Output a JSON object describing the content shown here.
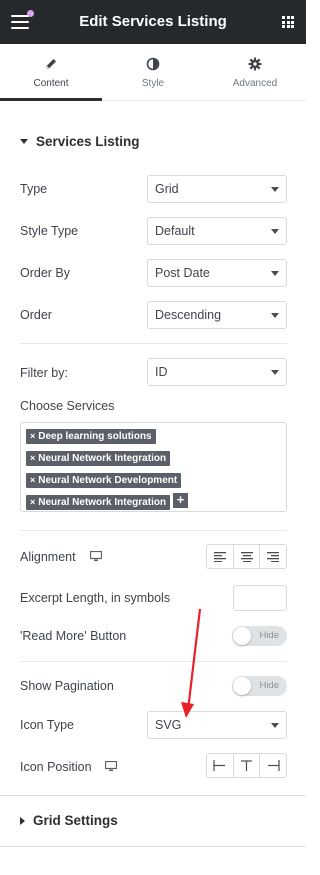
{
  "header": {
    "title": "Edit Services Listing"
  },
  "tabs": [
    {
      "label": "Content",
      "icon": "pencil-icon",
      "active": true
    },
    {
      "label": "Style",
      "icon": "half-circle-icon",
      "active": false
    },
    {
      "label": "Advanced",
      "icon": "gear-icon",
      "active": false
    }
  ],
  "services_section": {
    "title": "Services Listing",
    "type": {
      "label": "Type",
      "value": "Grid"
    },
    "style_type": {
      "label": "Style Type",
      "value": "Default"
    },
    "order_by": {
      "label": "Order By",
      "value": "Post Date"
    },
    "order": {
      "label": "Order",
      "value": "Descending"
    },
    "filter_by": {
      "label": "Filter by:",
      "value": "ID"
    },
    "choose_services": {
      "label": "Choose Services",
      "tags": [
        "Deep learning solutions",
        "Neural Network Integration",
        "Neural Network Development",
        "Neural Network Integration"
      ]
    },
    "alignment": {
      "label": "Alignment",
      "options": [
        "align-left",
        "align-center",
        "align-right"
      ]
    },
    "excerpt_length": {
      "label": "Excerpt Length, in symbols",
      "value": ""
    },
    "read_more": {
      "label": "'Read More' Button",
      "toggle_text": "Hide",
      "on": false
    },
    "show_pagination": {
      "label": "Show Pagination",
      "toggle_text": "Hide",
      "on": false
    },
    "icon_type": {
      "label": "Icon Type",
      "value": "SVG"
    },
    "icon_position": {
      "label": "Icon Position",
      "options": [
        "position-left",
        "position-top",
        "position-right"
      ]
    }
  },
  "grid_section": {
    "title": "Grid Settings"
  },
  "colors": {
    "header_bg": "#26292c",
    "accent_dot": "#d9a6ee",
    "tag_bg": "#5b6068",
    "arrow": "#e8202a"
  }
}
